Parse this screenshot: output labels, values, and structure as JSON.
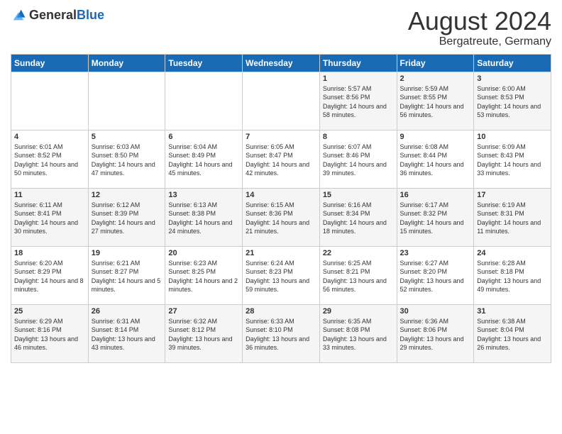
{
  "header": {
    "logo_general": "General",
    "logo_blue": "Blue",
    "month_title": "August 2024",
    "location": "Bergatreute, Germany"
  },
  "days_of_week": [
    "Sunday",
    "Monday",
    "Tuesday",
    "Wednesday",
    "Thursday",
    "Friday",
    "Saturday"
  ],
  "weeks": [
    [
      {
        "day": "",
        "content": ""
      },
      {
        "day": "",
        "content": ""
      },
      {
        "day": "",
        "content": ""
      },
      {
        "day": "",
        "content": ""
      },
      {
        "day": "1",
        "content": "Sunrise: 5:57 AM\nSunset: 8:56 PM\nDaylight: 14 hours and 58 minutes."
      },
      {
        "day": "2",
        "content": "Sunrise: 5:59 AM\nSunset: 8:55 PM\nDaylight: 14 hours and 56 minutes."
      },
      {
        "day": "3",
        "content": "Sunrise: 6:00 AM\nSunset: 8:53 PM\nDaylight: 14 hours and 53 minutes."
      }
    ],
    [
      {
        "day": "4",
        "content": "Sunrise: 6:01 AM\nSunset: 8:52 PM\nDaylight: 14 hours and 50 minutes."
      },
      {
        "day": "5",
        "content": "Sunrise: 6:03 AM\nSunset: 8:50 PM\nDaylight: 14 hours and 47 minutes."
      },
      {
        "day": "6",
        "content": "Sunrise: 6:04 AM\nSunset: 8:49 PM\nDaylight: 14 hours and 45 minutes."
      },
      {
        "day": "7",
        "content": "Sunrise: 6:05 AM\nSunset: 8:47 PM\nDaylight: 14 hours and 42 minutes."
      },
      {
        "day": "8",
        "content": "Sunrise: 6:07 AM\nSunset: 8:46 PM\nDaylight: 14 hours and 39 minutes."
      },
      {
        "day": "9",
        "content": "Sunrise: 6:08 AM\nSunset: 8:44 PM\nDaylight: 14 hours and 36 minutes."
      },
      {
        "day": "10",
        "content": "Sunrise: 6:09 AM\nSunset: 8:43 PM\nDaylight: 14 hours and 33 minutes."
      }
    ],
    [
      {
        "day": "11",
        "content": "Sunrise: 6:11 AM\nSunset: 8:41 PM\nDaylight: 14 hours and 30 minutes."
      },
      {
        "day": "12",
        "content": "Sunrise: 6:12 AM\nSunset: 8:39 PM\nDaylight: 14 hours and 27 minutes."
      },
      {
        "day": "13",
        "content": "Sunrise: 6:13 AM\nSunset: 8:38 PM\nDaylight: 14 hours and 24 minutes."
      },
      {
        "day": "14",
        "content": "Sunrise: 6:15 AM\nSunset: 8:36 PM\nDaylight: 14 hours and 21 minutes."
      },
      {
        "day": "15",
        "content": "Sunrise: 6:16 AM\nSunset: 8:34 PM\nDaylight: 14 hours and 18 minutes."
      },
      {
        "day": "16",
        "content": "Sunrise: 6:17 AM\nSunset: 8:32 PM\nDaylight: 14 hours and 15 minutes."
      },
      {
        "day": "17",
        "content": "Sunrise: 6:19 AM\nSunset: 8:31 PM\nDaylight: 14 hours and 11 minutes."
      }
    ],
    [
      {
        "day": "18",
        "content": "Sunrise: 6:20 AM\nSunset: 8:29 PM\nDaylight: 14 hours and 8 minutes."
      },
      {
        "day": "19",
        "content": "Sunrise: 6:21 AM\nSunset: 8:27 PM\nDaylight: 14 hours and 5 minutes."
      },
      {
        "day": "20",
        "content": "Sunrise: 6:23 AM\nSunset: 8:25 PM\nDaylight: 14 hours and 2 minutes."
      },
      {
        "day": "21",
        "content": "Sunrise: 6:24 AM\nSunset: 8:23 PM\nDaylight: 13 hours and 59 minutes."
      },
      {
        "day": "22",
        "content": "Sunrise: 6:25 AM\nSunset: 8:21 PM\nDaylight: 13 hours and 56 minutes."
      },
      {
        "day": "23",
        "content": "Sunrise: 6:27 AM\nSunset: 8:20 PM\nDaylight: 13 hours and 52 minutes."
      },
      {
        "day": "24",
        "content": "Sunrise: 6:28 AM\nSunset: 8:18 PM\nDaylight: 13 hours and 49 minutes."
      }
    ],
    [
      {
        "day": "25",
        "content": "Sunrise: 6:29 AM\nSunset: 8:16 PM\nDaylight: 13 hours and 46 minutes."
      },
      {
        "day": "26",
        "content": "Sunrise: 6:31 AM\nSunset: 8:14 PM\nDaylight: 13 hours and 43 minutes."
      },
      {
        "day": "27",
        "content": "Sunrise: 6:32 AM\nSunset: 8:12 PM\nDaylight: 13 hours and 39 minutes."
      },
      {
        "day": "28",
        "content": "Sunrise: 6:33 AM\nSunset: 8:10 PM\nDaylight: 13 hours and 36 minutes."
      },
      {
        "day": "29",
        "content": "Sunrise: 6:35 AM\nSunset: 8:08 PM\nDaylight: 13 hours and 33 minutes."
      },
      {
        "day": "30",
        "content": "Sunrise: 6:36 AM\nSunset: 8:06 PM\nDaylight: 13 hours and 29 minutes."
      },
      {
        "day": "31",
        "content": "Sunrise: 6:38 AM\nSunset: 8:04 PM\nDaylight: 13 hours and 26 minutes."
      }
    ]
  ]
}
